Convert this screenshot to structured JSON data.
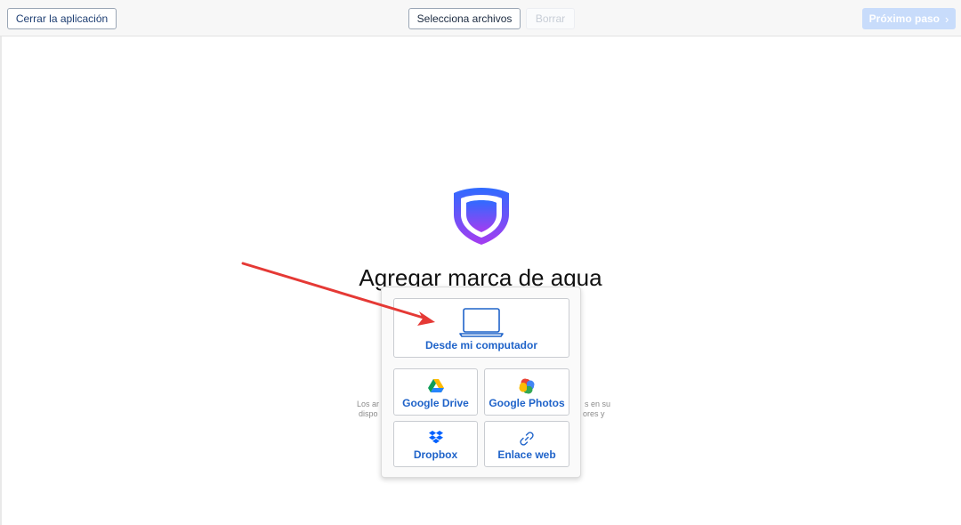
{
  "toolbar": {
    "close_label": "Cerrar la aplicación",
    "select_label": "Selecciona archivos",
    "delete_label": "Borrar",
    "next_label": "Próximo paso",
    "next_icon": "chevron-right-icon"
  },
  "main": {
    "logo_icon": "shield-icon",
    "title": "Agregar marca de agua",
    "desc_left_1": "Los ar",
    "desc_left_2": "dispo",
    "desc_right_1": "s en su",
    "desc_right_2": "ores y"
  },
  "menu": {
    "computer_label": "Desde mi computador",
    "drive_label": "Google Drive",
    "photos_label": "Google Photos",
    "dropbox_label": "Dropbox",
    "web_label": "Enlace web"
  },
  "colors": {
    "accent": "#1f63c9",
    "next_button_disabled": "#c8dcfb",
    "arrow": "#e53935",
    "shield_top": "#2f6bff",
    "shield_bottom": "#a53cf0"
  }
}
